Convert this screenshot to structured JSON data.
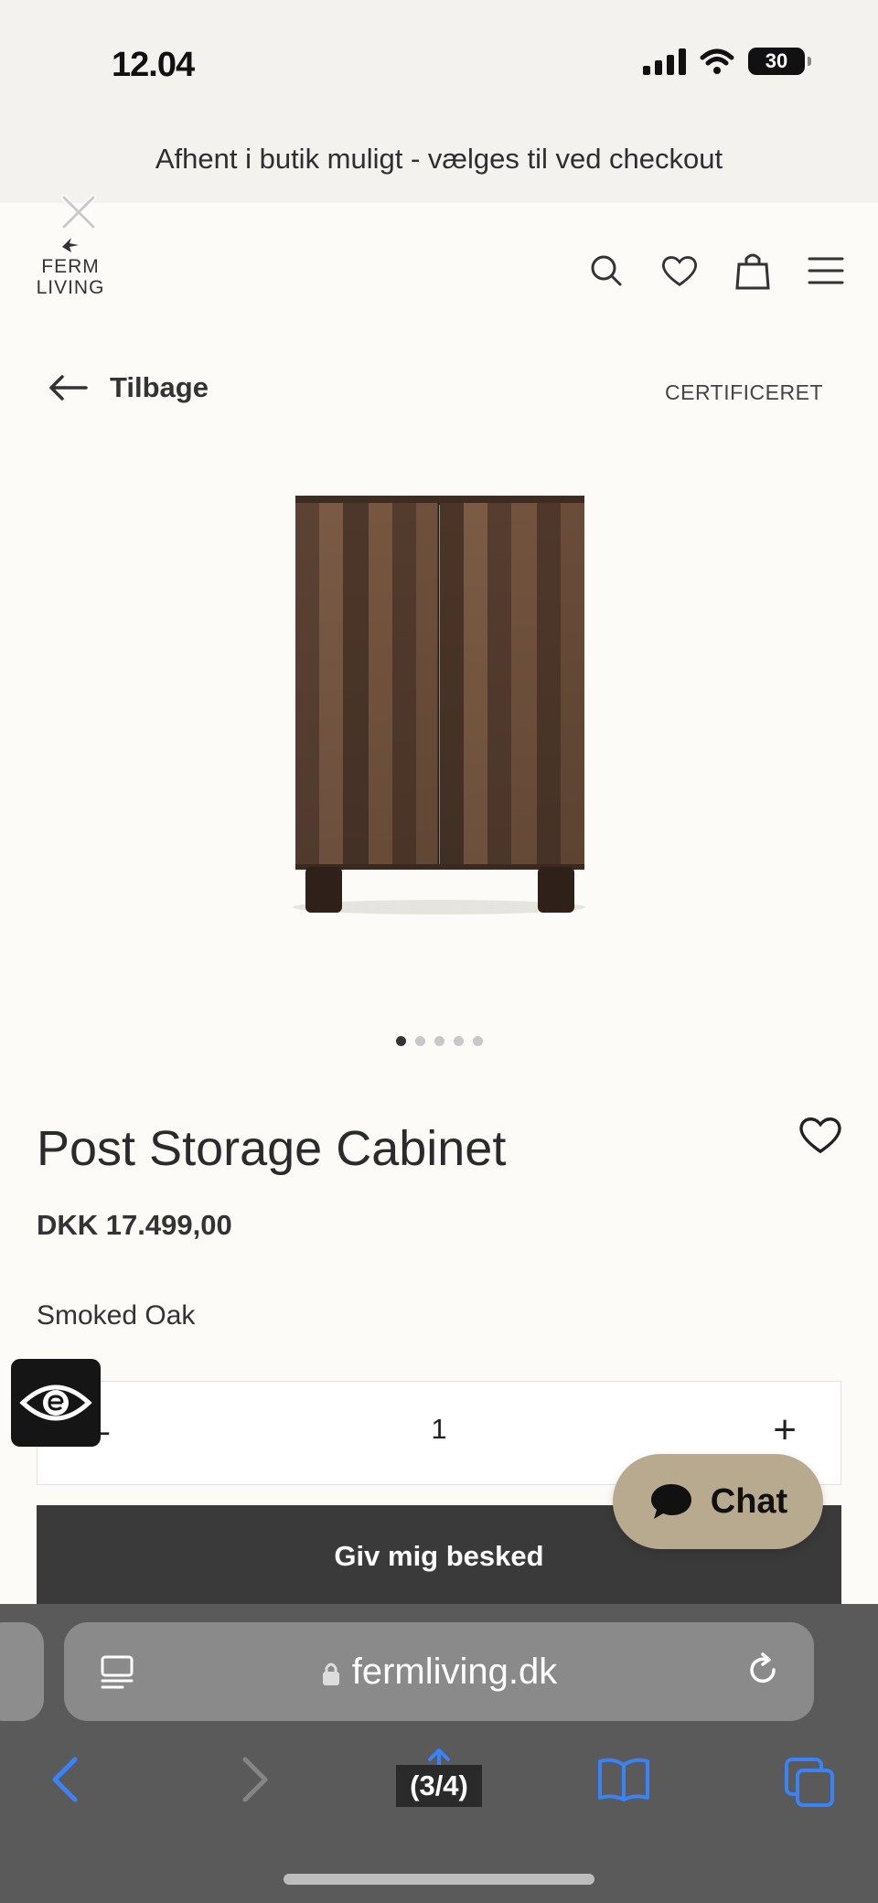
{
  "status_bar": {
    "time": "12.04",
    "battery": "30",
    "icons": [
      "cellular-signal-icon",
      "wifi-icon",
      "battery-icon"
    ]
  },
  "promo_banner": {
    "text": "Afhent i butik muligt - vælges til ved checkout"
  },
  "header": {
    "logo_line1": "FERM",
    "logo_line2": "LIVING",
    "icons": [
      "search-icon",
      "heart-icon",
      "shopping-bag-icon",
      "menu-icon"
    ]
  },
  "nav": {
    "back_label": "Tilbage",
    "certified_label": "CERTIFICERET"
  },
  "gallery": {
    "total_images": 5,
    "active_index": 0
  },
  "product": {
    "title": "Post Storage Cabinet",
    "price": "DKK 17.499,00",
    "variant": "Smoked Oak",
    "quantity": "1",
    "minus_label": "–",
    "plus_label": "+",
    "notify_button": "Giv mig besked"
  },
  "chat": {
    "label": "Chat"
  },
  "browser": {
    "url": "fermliving.dk",
    "pager": "(3/4)"
  },
  "colors": {
    "background": "#fcfbf8",
    "banner": "#f3f2ef",
    "button_dark": "#3a3a3a",
    "chat_bg": "#b8aa8e",
    "browser_chrome": "#5a5a5a",
    "ios_blue": "#3a82f7"
  }
}
